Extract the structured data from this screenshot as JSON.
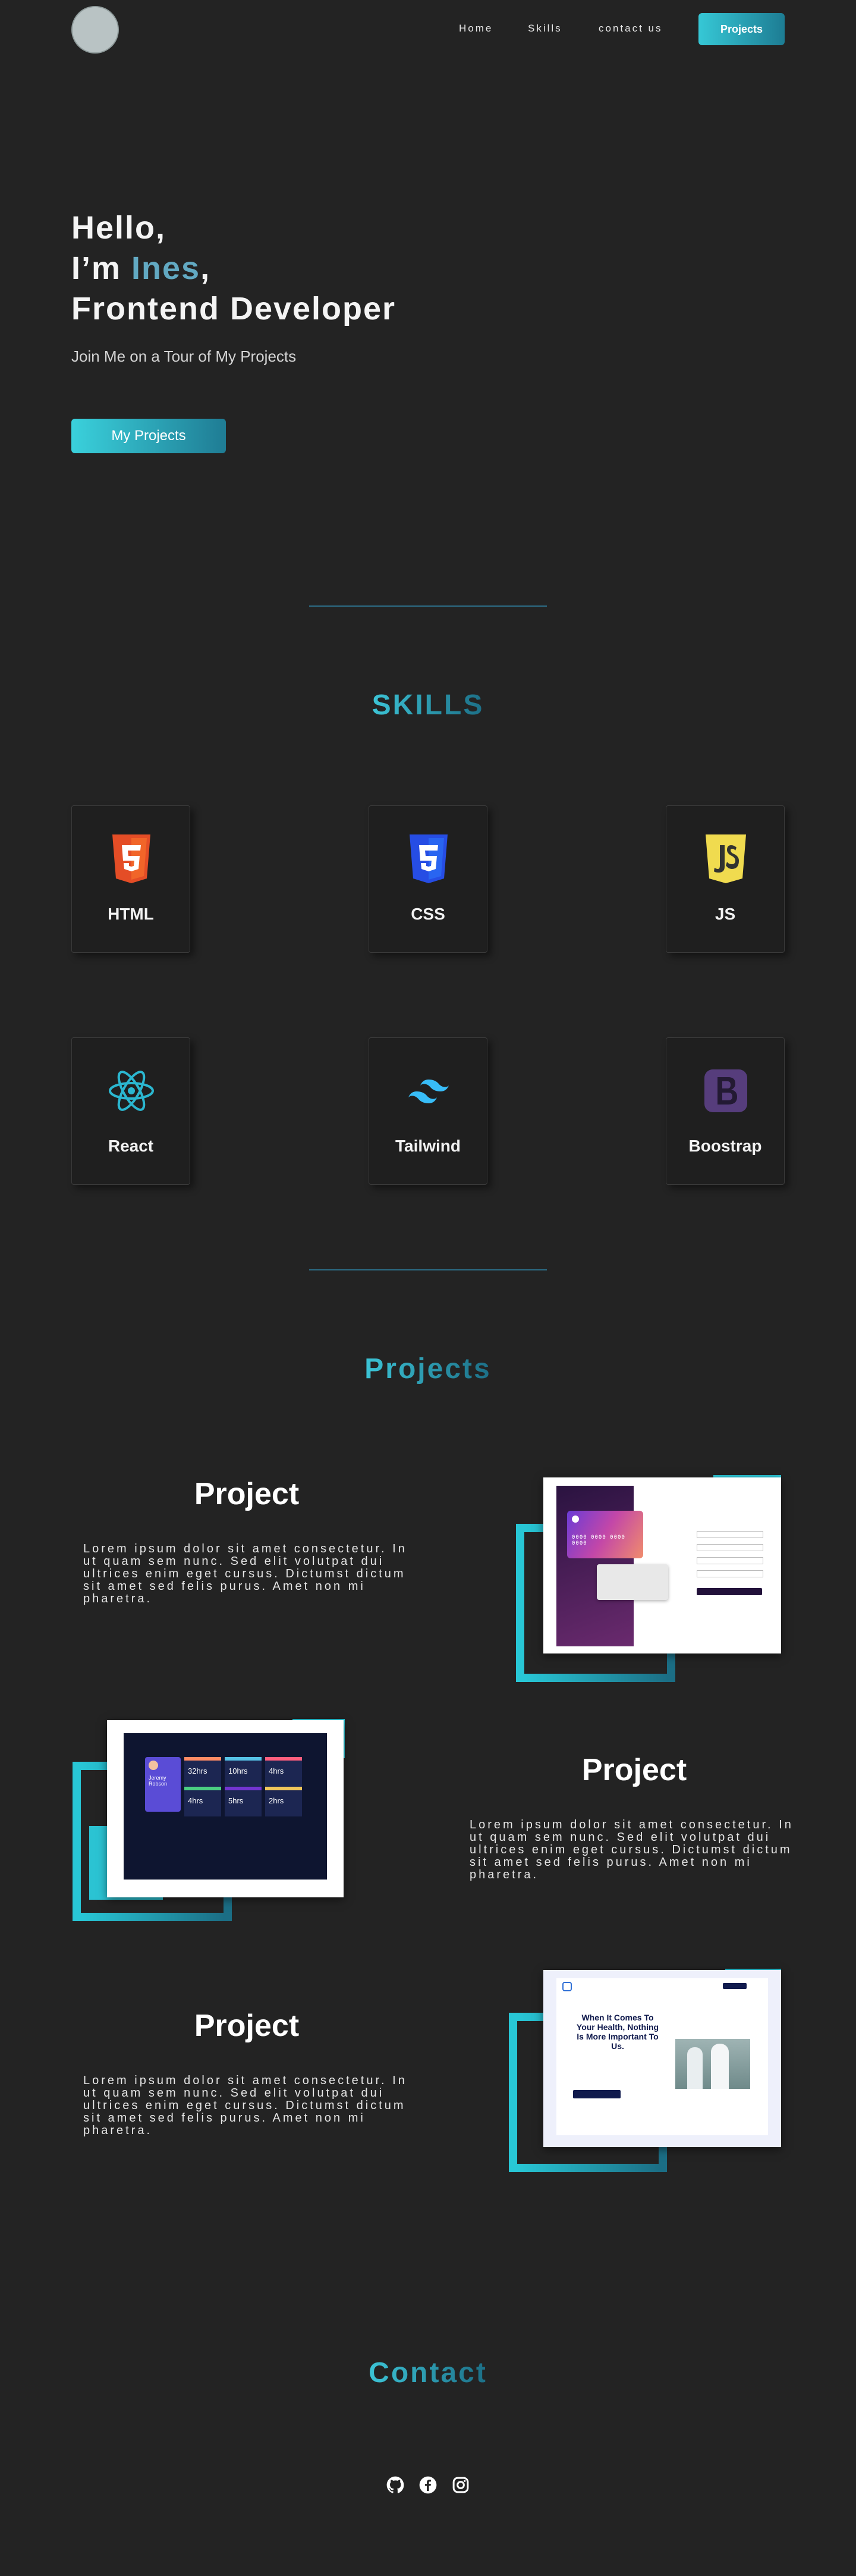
{
  "nav": {
    "links": [
      "Home",
      "Skills",
      "contact us"
    ],
    "cta": "Projects"
  },
  "hero": {
    "line1": "Hello,",
    "line2_prefix": "I’m ",
    "line2_name": "Ines",
    "line2_suffix": ",",
    "line3": "Frontend Developer",
    "subtitle": "Join Me on a Tour of My Projects",
    "button": "My Projects"
  },
  "skills": {
    "title": "SKILLS",
    "items": [
      {
        "label": "HTML",
        "icon": "html5-icon",
        "color": "#e44d26"
      },
      {
        "label": "CSS",
        "icon": "css3-icon",
        "color": "#264de4"
      },
      {
        "label": "JS",
        "icon": "js-icon",
        "color": "#f0db4f"
      },
      {
        "label": "React",
        "icon": "react-icon",
        "color": "#2bb7d0"
      },
      {
        "label": "Tailwind",
        "icon": "tailwind-icon",
        "color": "#38bdf8"
      },
      {
        "label": "Boostrap",
        "icon": "bootstrap-icon",
        "color": "#563d7c"
      }
    ]
  },
  "projects": {
    "title": "Projects",
    "items": [
      {
        "title": "Project",
        "desc": "Lorem ipsum dolor sit amet consectetur. In ut quam sem nunc. Sed elit volutpat dui ultrices enim eget cursus. Dictumst dictum sit amet sed felis purus. Amet non mi pharetra."
      },
      {
        "title": "Project",
        "desc": "Lorem ipsum dolor sit amet consectetur. In ut quam sem nunc. Sed elit volutpat dui ultrices enim eget cursus. Dictumst dictum sit amet sed felis purus. Amet non mi pharetra."
      },
      {
        "title": "Project",
        "desc": "Lorem ipsum dolor sit amet consectetur. In ut quam sem nunc. Sed elit volutpat dui ultrices enim eget cursus. Dictumst dictum sit amet sed felis purus. Amet non mi pharetra."
      }
    ],
    "screens": {
      "card_text": "0000 0000 0000 0000",
      "dashboard_name": "Jeremy Robson",
      "dashboard_values": [
        "32hrs",
        "10hrs",
        "4hrs",
        "4hrs",
        "5hrs",
        "2hrs"
      ],
      "health_heading": "When It Comes To Your Health, Nothing Is More Important To Us."
    }
  },
  "contact": {
    "title": "Contact",
    "socials": [
      "github-icon",
      "facebook-icon",
      "instagram-icon"
    ]
  },
  "colors": {
    "background": "#232323",
    "accent_start": "#36c8d6",
    "accent_end": "#1d7c93"
  }
}
